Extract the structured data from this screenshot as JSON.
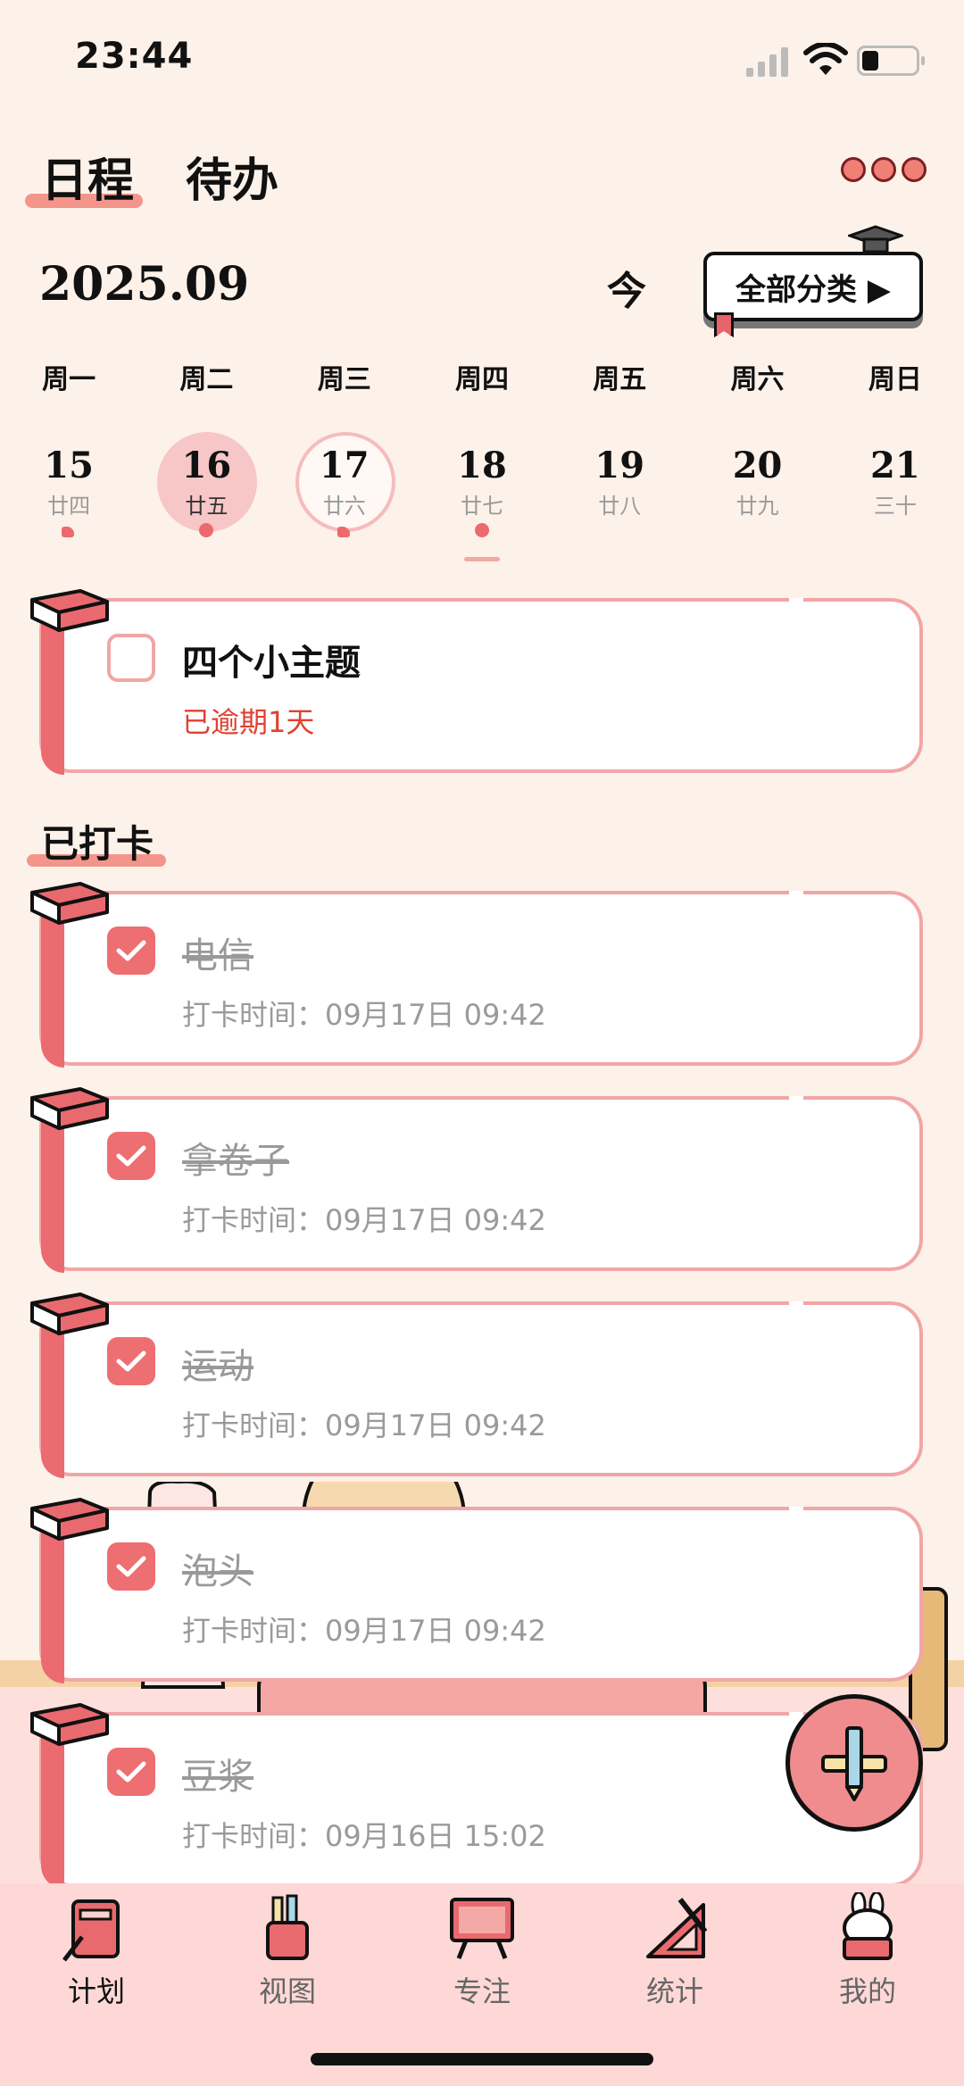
{
  "status_bar": {
    "time": "23:44"
  },
  "header": {
    "tabs": [
      {
        "label": "日程",
        "active": true
      },
      {
        "label": "待办",
        "active": false
      }
    ]
  },
  "toolbar": {
    "month": "2025.09",
    "today_label": "今",
    "category_label": "全部分类 ▶"
  },
  "week": {
    "weekdays": [
      "周一",
      "周二",
      "周三",
      "周四",
      "周五",
      "周六",
      "周日"
    ],
    "days": [
      {
        "num": "15",
        "lunar": "廿四"
      },
      {
        "num": "16",
        "lunar": "廿五"
      },
      {
        "num": "17",
        "lunar": "廿六"
      },
      {
        "num": "18",
        "lunar": "廿七"
      },
      {
        "num": "19",
        "lunar": "廿八"
      },
      {
        "num": "20",
        "lunar": "廿九"
      },
      {
        "num": "21",
        "lunar": "三十"
      }
    ]
  },
  "pending": [
    {
      "title": "四个小主题",
      "status": "已逾期1天"
    }
  ],
  "checked_section_title": "已打卡",
  "checked": [
    {
      "title": "电信",
      "time": "打卡时间：09月17日 09:42"
    },
    {
      "title": "拿卷子",
      "time": "打卡时间：09月17日 09:42"
    },
    {
      "title": "运动",
      "time": "打卡时间：09月17日 09:42"
    },
    {
      "title": "泡头",
      "time": "打卡时间：09月17日 09:42"
    },
    {
      "title": "豆浆",
      "time": "打卡时间：09月16日 15:02"
    }
  ],
  "bottom_nav": [
    {
      "label": "计划",
      "icon": "book-icon",
      "active": true
    },
    {
      "label": "视图",
      "icon": "pencil-cup-icon",
      "active": false
    },
    {
      "label": "专注",
      "icon": "blackboard-icon",
      "active": false
    },
    {
      "label": "统计",
      "icon": "ruler-icon",
      "active": false
    },
    {
      "label": "我的",
      "icon": "bunny-icon",
      "active": false
    }
  ],
  "colors": {
    "accent": "#ec6b70",
    "background": "#fdf2ea",
    "nav_background": "#fdd8d6"
  }
}
